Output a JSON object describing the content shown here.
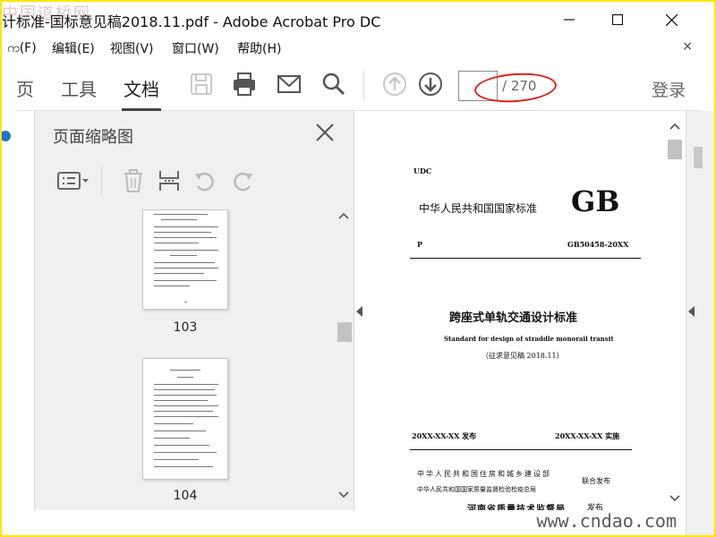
{
  "window": {
    "title": "计标准-国标意见稿2018.11.pdf - Adobe Acrobat Pro DC",
    "watermark": "中国道桥网"
  },
  "menu": [
    "က(F)",
    "编辑(E)",
    "视图(V)",
    "窗口(W)",
    "帮助(H)"
  ],
  "tabs": {
    "home": "页",
    "tools": "工具",
    "document": "文档"
  },
  "toolbar": {
    "page_value": "",
    "page_count": "/ 270",
    "signin": "登录"
  },
  "panel": {
    "title": "页面缩略图",
    "thumbnails": [
      {
        "label": "103"
      },
      {
        "label": "104"
      }
    ]
  },
  "document": {
    "udc": "UDC",
    "country_std": "中华人民共和国国家标准",
    "gb": "GB",
    "p": "P",
    "code": "GB50458-20XX",
    "title_cn": "跨座式单轨交通设计标准",
    "title_en": "Standard for design of straddle monorail transit",
    "draft": "（征求意见稿 2018.11）",
    "publish_date": "20XX-XX-XX 发布",
    "impl_date": "20XX-XX-XX 实施",
    "issuer1": "中华人民共和国住房和城乡建设部",
    "issuer2": "中华人民共和国国家质量监督检验检疫总局",
    "joint": "联合发布",
    "issuer3": "河南省质量技术监督局",
    "issue": "发布"
  },
  "footer": {
    "brand": "www.cndao.com"
  },
  "colors": {
    "accent_red": "#e0201a",
    "frame": "#ffe600"
  }
}
